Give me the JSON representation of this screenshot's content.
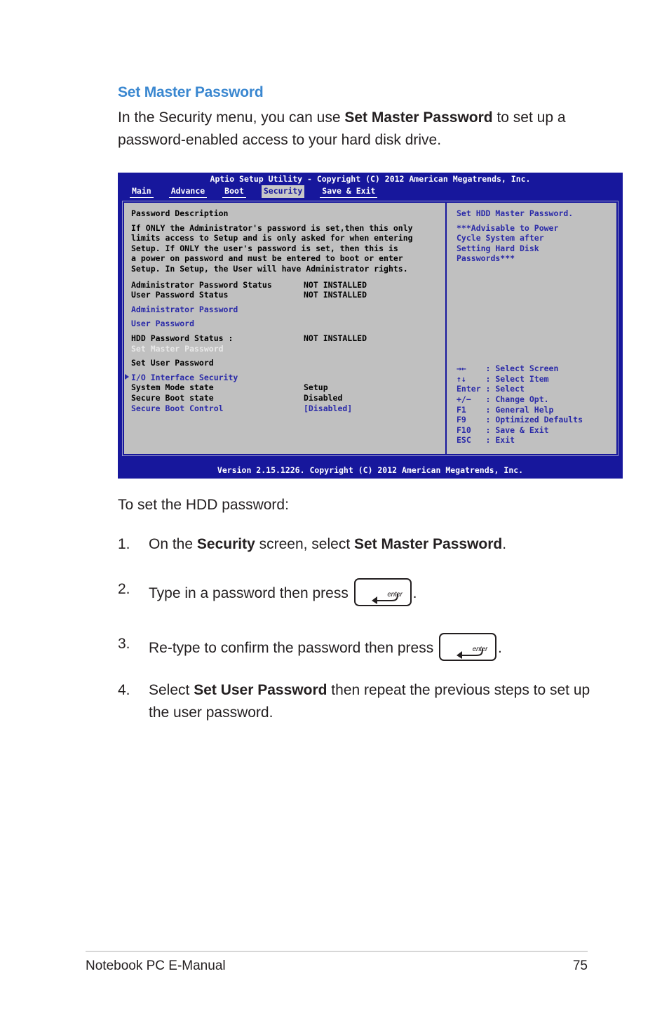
{
  "section": {
    "heading": "Set Master Password",
    "intro_pre": "In the Security menu, you can use ",
    "intro_bold": "Set Master Password",
    "intro_post": " to set up a password-enabled access to your hard disk drive."
  },
  "bios": {
    "title": "Aptio Setup Utility - Copyright (C) 2012 American Megatrends, Inc.",
    "tabs": [
      {
        "label": "Main",
        "active": false
      },
      {
        "label": "Advance",
        "active": false
      },
      {
        "label": "Boot",
        "active": false
      },
      {
        "label": "Security",
        "active": true
      },
      {
        "label": "Save & Exit",
        "active": false
      }
    ],
    "left": {
      "section_title": "Password Description",
      "description_lines": [
        "If ONLY the Administrator's password is set,then this only",
        "limits access to Setup and is only asked for when entering",
        "Setup. If ONLY the user's password is set, then this is",
        "a power on password and must be entered to boot or enter",
        "Setup. In Setup, the User will have Administrator rights."
      ],
      "rows": [
        {
          "label": "Administrator Password Status",
          "value": "NOT INSTALLED",
          "style": "black"
        },
        {
          "label": "User Password Status",
          "value": "NOT INSTALLED",
          "style": "black"
        },
        {
          "label": "Administrator Password",
          "value": "",
          "style": "blue"
        },
        {
          "label": "User Password",
          "value": "",
          "style": "blue"
        },
        {
          "label": "HDD Password Status :",
          "value": "NOT INSTALLED",
          "style": "black"
        },
        {
          "label": "Set Master Password",
          "value": "",
          "style": "selected"
        },
        {
          "label": "Set User Password",
          "value": "",
          "style": "black"
        },
        {
          "label": "I/O Interface Security",
          "value": "",
          "style": "blue-arrow"
        },
        {
          "label": "System Mode state",
          "value": "Setup",
          "style": "black"
        },
        {
          "label": "Secure Boot state",
          "value": "Disabled",
          "style": "black"
        },
        {
          "label": "Secure Boot Control",
          "value": "[Disabled]",
          "style": "blue"
        }
      ]
    },
    "right": {
      "help_title": "Set HDD Master Password.",
      "help_lines": [
        "***Advisable to Power",
        "Cycle System after",
        "Setting Hard Disk",
        "Passwords***"
      ],
      "keys": [
        {
          "key": "→←",
          "sep": ":",
          "action": "Select Screen"
        },
        {
          "key": "↑↓",
          "sep": ":",
          "action": "Select Item"
        },
        {
          "key": "Enter",
          "sep": ":",
          "action": "Select"
        },
        {
          "key": "+/−",
          "sep": ":",
          "action": "Change Opt."
        },
        {
          "key": "F1",
          "sep": ":",
          "action": "General Help"
        },
        {
          "key": "F9",
          "sep": ":",
          "action": "Optimized Defaults"
        },
        {
          "key": "F10",
          "sep": ":",
          "action": "Save & Exit"
        },
        {
          "key": "ESC",
          "sep": ":",
          "action": "Exit"
        }
      ]
    },
    "version": "Version 2.15.1226. Copyright (C) 2012 American Megatrends, Inc.",
    "colors": {
      "chrome_blue": "#17179c",
      "panel_gray": "#c0c0c0",
      "item_blue": "#2a2aa8",
      "selected_text": "#e8e8e8"
    }
  },
  "steps": {
    "lead": "To set the HDD password:",
    "items": [
      {
        "num": "1.",
        "pre": "On the ",
        "bold1": "Security",
        "mid": " screen, select ",
        "bold2": "Set Master Password",
        "post": ".",
        "key": null
      },
      {
        "num": "2.",
        "pre": "Type in a password then press ",
        "bold1": "",
        "mid": "",
        "bold2": "",
        "post": ".",
        "key": "enter"
      },
      {
        "num": "3.",
        "pre": "Re-type to confirm the password then press ",
        "bold1": "",
        "mid": "",
        "bold2": "",
        "post": ".",
        "key": "enter"
      },
      {
        "num": "4.",
        "pre": "Select ",
        "bold1": "Set User Password",
        "mid": " then repeat the previous steps to set up the user password.",
        "bold2": "",
        "post": "",
        "key": null
      }
    ]
  },
  "footer": {
    "left": "Notebook PC E-Manual",
    "page": "75"
  },
  "accent_color": "#3a87d0"
}
